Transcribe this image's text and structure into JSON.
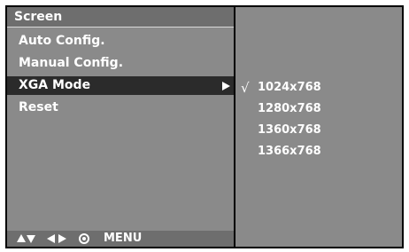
{
  "osd": {
    "title": "Screen",
    "items": [
      {
        "label": "Auto Config."
      },
      {
        "label": "Manual Config."
      },
      {
        "label": "XGA Mode"
      },
      {
        "label": "Reset"
      }
    ],
    "footer": {
      "nav_icons": [
        "up-down-arrows-icon",
        "left-right-arrows-icon",
        "ok-button-icon"
      ],
      "menu_label": "MENU"
    }
  },
  "submenu": {
    "check_mark": "√",
    "options": [
      {
        "label": "1024x768",
        "checked": true
      },
      {
        "label": "1280x768",
        "checked": false
      },
      {
        "label": "1360x768",
        "checked": false
      },
      {
        "label": "1366x768",
        "checked": false
      }
    ]
  },
  "colors": {
    "panel_bg": "#8a8a8a",
    "title_bg": "#6e6e6e",
    "selected_bg": "#2b2b2b",
    "text": "#ffffff"
  }
}
